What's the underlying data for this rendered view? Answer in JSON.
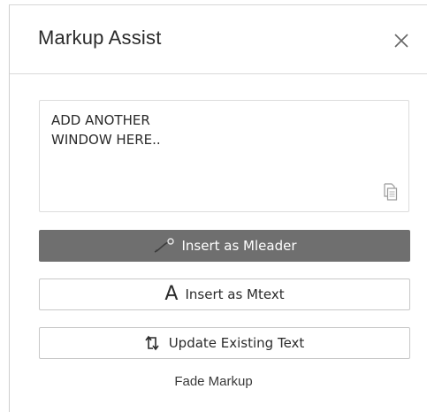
{
  "header": {
    "title": "Markup Assist",
    "close_icon": "close-icon"
  },
  "markup_text": {
    "value": "ADD ANOTHER\nWINDOW HERE..",
    "copy_icon": "copy-icon"
  },
  "actions": {
    "insert_mleader": {
      "label": "Insert as Mleader",
      "icon": "mleader-icon"
    },
    "insert_mtext": {
      "label": "Insert as Mtext",
      "icon_text": "A"
    },
    "update_text": {
      "label": "Update Existing Text",
      "icon": "refresh-icon"
    }
  },
  "fade_markup": {
    "label": "Fade Markup"
  },
  "colors": {
    "primary_button": "#6f6f6f",
    "border": "#c8c8c8",
    "text": "#2b2b2b"
  }
}
